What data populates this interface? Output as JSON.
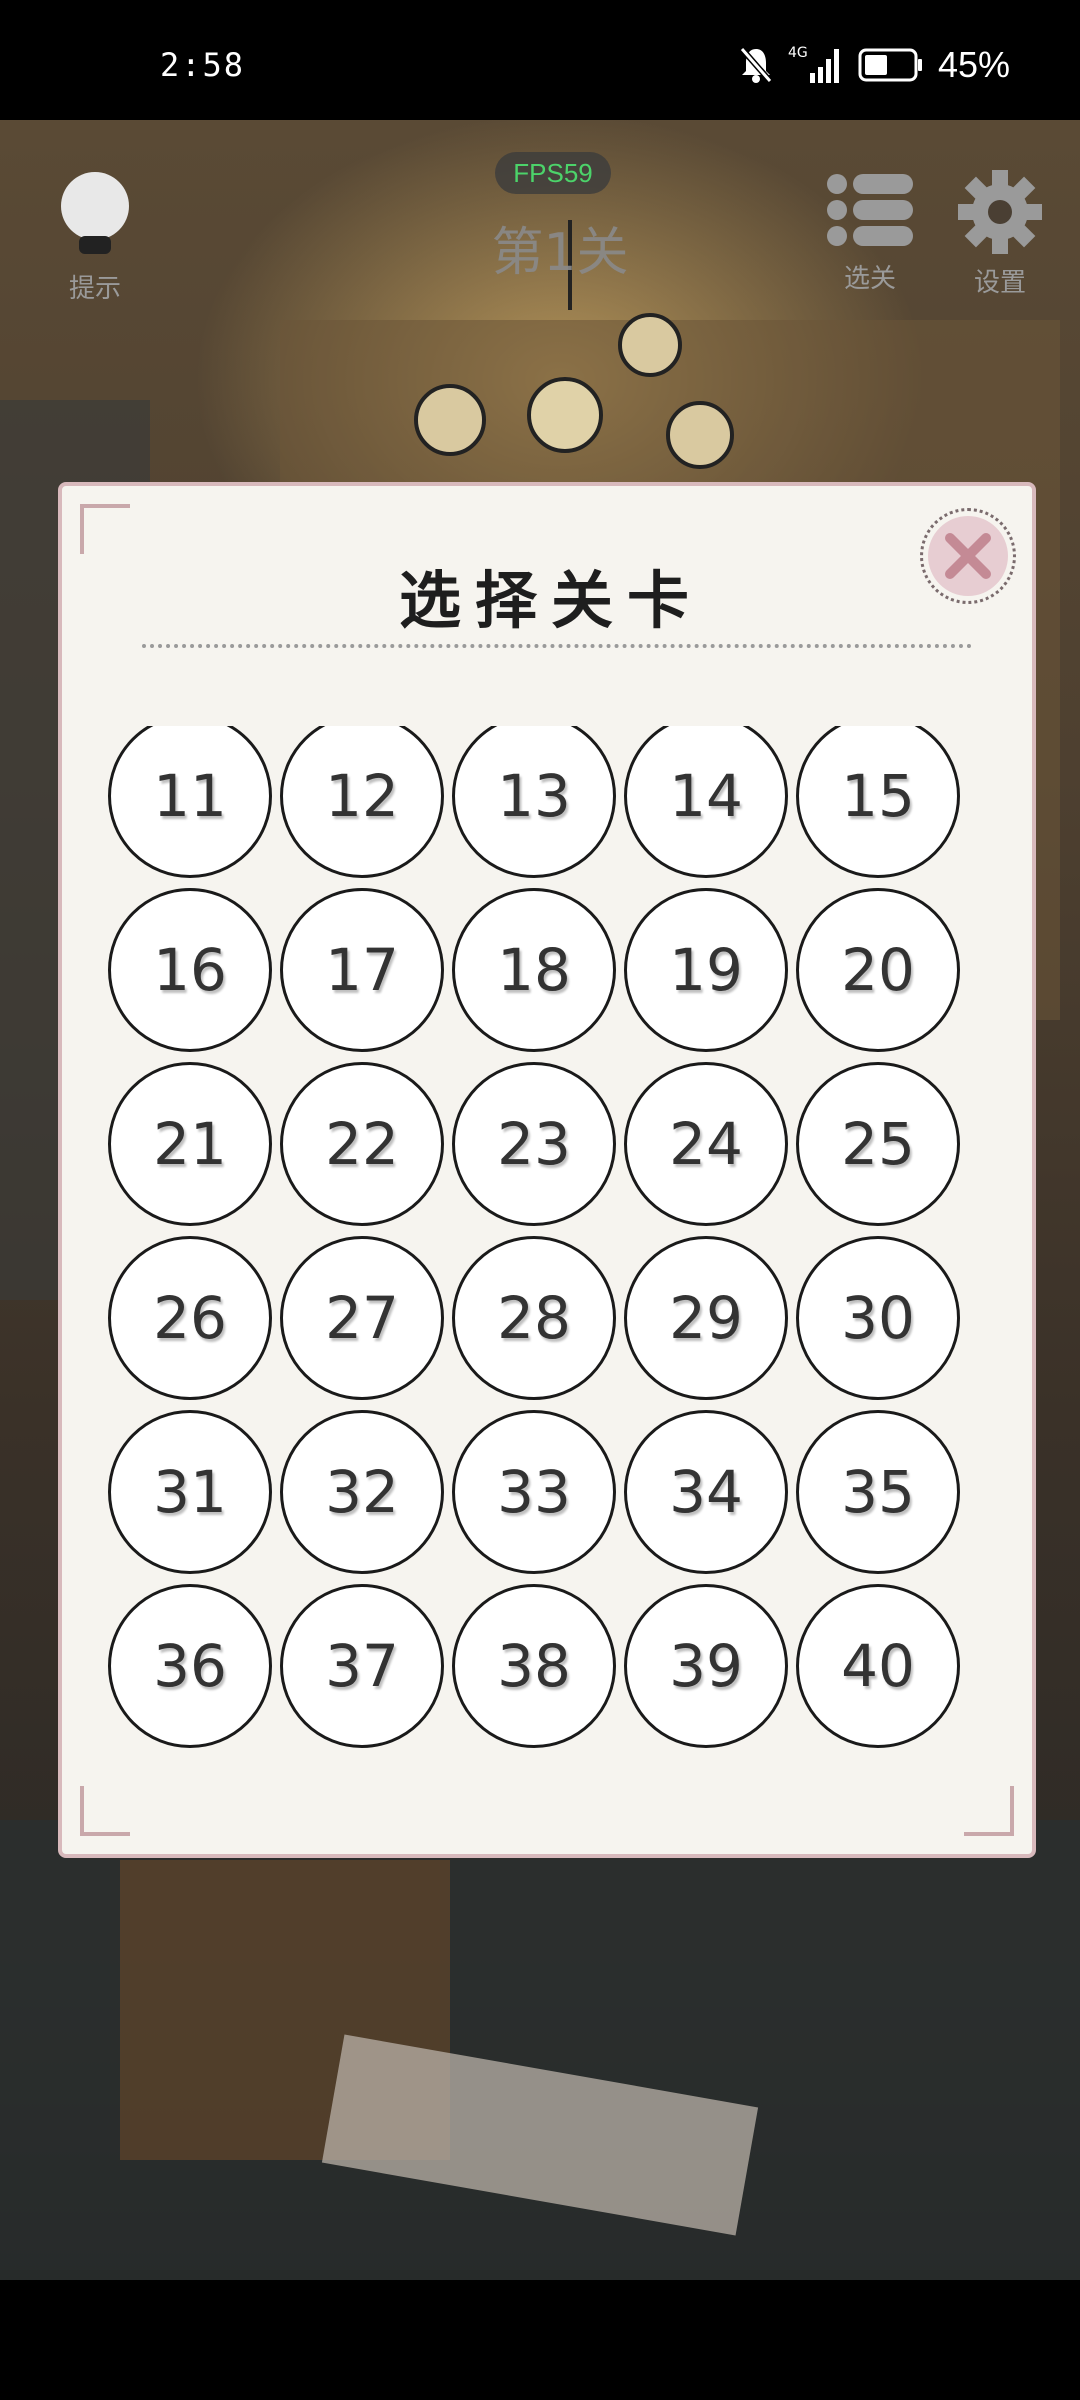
{
  "status_bar": {
    "time": "2:58",
    "network": "4G",
    "battery_percent": "45%"
  },
  "hud": {
    "hint_label": "提示",
    "level_title": "第1关",
    "fps": "FPS59",
    "levels_label": "选关",
    "settings_label": "设置"
  },
  "dialog": {
    "title": "选择关卡",
    "close_icon": "close-icon",
    "levels": [
      "11",
      "12",
      "13",
      "14",
      "15",
      "16",
      "17",
      "18",
      "19",
      "20",
      "21",
      "22",
      "23",
      "24",
      "25",
      "26",
      "27",
      "28",
      "29",
      "30",
      "31",
      "32",
      "33",
      "34",
      "35",
      "36",
      "37",
      "38",
      "39",
      "40"
    ]
  },
  "colors": {
    "dialog_bg": "#f6f4ef",
    "dialog_border": "#d8b9bc",
    "close_bg": "#e7cdd2",
    "close_x": "#c48a95",
    "fps_text": "#4cd36a"
  }
}
